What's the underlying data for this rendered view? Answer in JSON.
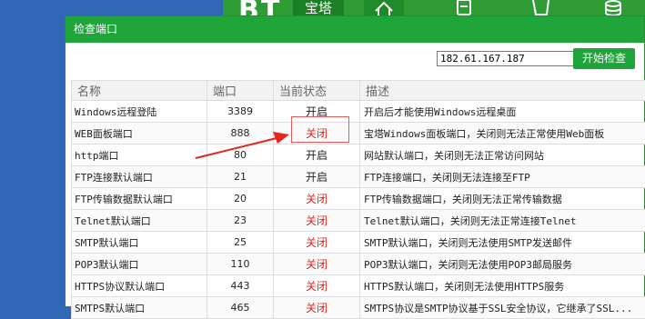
{
  "background": {
    "logo": "BT",
    "brand": "宝塔"
  },
  "dialog": {
    "title": "检查端口",
    "ip_select": {
      "value": "182.61.167.187"
    },
    "start_button": "开始检查"
  },
  "table": {
    "headers": [
      "名称",
      "端口",
      "当前状态",
      "描述"
    ],
    "rows": [
      {
        "name": "Windows远程登陆",
        "port": "3389",
        "status": "开启",
        "desc": "开启后才能使用Windows远程桌面"
      },
      {
        "name": "WEB面板端口",
        "port": "888",
        "status": "关闭",
        "desc": "宝塔Windows面板端口，关闭则无法正常使用Web面板"
      },
      {
        "name": "http端口",
        "port": "80",
        "status": "开启",
        "desc": "网站默认端口，关闭则无法正常访问网站"
      },
      {
        "name": "FTP连接默认端口",
        "port": "21",
        "status": "开启",
        "desc": "FTP连接端口，关闭则无法连接至FTP"
      },
      {
        "name": "FTP传输数据默认端口",
        "port": "20",
        "status": "关闭",
        "desc": "FTP传输数据端口，关闭则无法正常传输数据"
      },
      {
        "name": "Telnet默认端口",
        "port": "23",
        "status": "关闭",
        "desc": "Telnet默认端口，关闭则无法正常连接Telnet"
      },
      {
        "name": "SMTP默认端口",
        "port": "25",
        "status": "关闭",
        "desc": "SMTP默认端口，关闭则无法使用SMTP发送邮件"
      },
      {
        "name": "POP3默认端口",
        "port": "110",
        "status": "关闭",
        "desc": "POP3默认端口，关闭则无法使用POP3邮局服务"
      },
      {
        "name": "HTTPS协议默认端口",
        "port": "443",
        "status": "关闭",
        "desc": "HTTPS默认端口，关闭则无法使用HTTPS服务"
      },
      {
        "name": "SMTPS默认端口",
        "port": "465",
        "status": "关闭",
        "desc": "SMTPS协议是SMTP协议基于SSL安全协议，它继承了SSL..."
      }
    ]
  },
  "colors": {
    "accent": "#20a53a",
    "closed": "#e8231c",
    "annotation": "#e8231c"
  },
  "icons": [
    "home-icon",
    "document-icon",
    "folder-icon",
    "database-icon",
    "dropdown-arrow-icon"
  ]
}
